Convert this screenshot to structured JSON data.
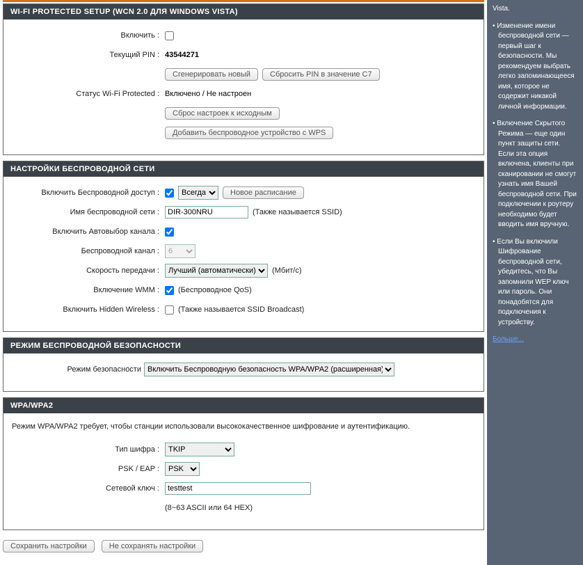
{
  "wps": {
    "title": "WI-FI PROTECTED SETUP (WCN 2.0 ДЛЯ WINDOWS VISTA)",
    "enable_label": "Включить :",
    "enable_checked": false,
    "pin_label": "Текущий PIN :",
    "pin_value": "43544271",
    "btn_gen": "Сгенерировать новый",
    "btn_reset_pin": "Сбросить PIN в значение С7",
    "status_label": "Статус Wi-Fi Protected :",
    "status_value": "Включено / Не настроен",
    "btn_reset_cfg": "Сброс настроек к исходным",
    "btn_add_device": "Добавить беспроводное устройство с WPS"
  },
  "wireless": {
    "title": "НАСТРОЙКИ БЕСПРОВОДНОЙ СЕТИ",
    "enable_label": "Включить Беспроводной доступ :",
    "enable_checked": true,
    "schedule_value": "Всегда",
    "btn_new_schedule": "Новое расписание",
    "ssid_label": "Имя беспроводной сети :",
    "ssid_value": "DIR-300NRU",
    "ssid_note": "(Также называется SSID)",
    "auto_ch_label": "Включить Автовыбор канала :",
    "auto_ch_checked": true,
    "channel_label": "Беспроводной канал :",
    "channel_value": "6",
    "rate_label": "Скорость передачи :",
    "rate_value": "Лучший (автоматически)",
    "rate_unit": "(Мбит/с)",
    "wmm_label": "Включение WMM :",
    "wmm_checked": true,
    "wmm_note": "(Беспроводное QoS)",
    "hidden_label": "Включить Hidden Wireless :",
    "hidden_checked": false,
    "hidden_note": "(Также называется SSID Broadcast)"
  },
  "security": {
    "title": "РЕЖИМ БЕСПРОВОДНОЙ БЕЗОПАСНОСТИ",
    "mode_label": "Режим безопасности",
    "mode_value": "Включить Беспроводную безопасность WPA/WPA2 (расширенная)"
  },
  "wpa": {
    "title": "WPA/WPA2",
    "desc": "Режим WPA/WPA2 требует, чтобы станции использовали высококачественное шифрование и аутентификацию.",
    "cipher_label": "Тип шифра :",
    "cipher_value": "TKIP",
    "psk_label": "PSK / EAP :",
    "psk_value": "PSK",
    "key_label": "Сетевой ключ :",
    "key_value": "testtest",
    "key_note": "(8~63 ASCII или 64 HEX)"
  },
  "buttons": {
    "save": "Сохранить настройки",
    "cancel": "Не сохранять настройки"
  },
  "sidebar": {
    "p0": "Vista.",
    "p1": "• Изменение имени беспроводной сети — первый шаг к безопасности. Мы рекомендуем выбрать легко запоминающееся имя, которое не содержит никакой личной информации.",
    "p2": "• Включение Скрытого Режима — еще один пункт защиты сети. Если эта опция включена, клиенты при сканировании не смогут узнать имя Вашей беспроводной сети. При подключении к роутеру необходимо будет вводить имя вручную.",
    "p3": "• Если Вы включили Шифрование беспроводной сети, убедитесь, что Вы запомнили WEP ключ или пароль. Они понадобятся для подключения к устройству.",
    "more": "Больше..."
  }
}
